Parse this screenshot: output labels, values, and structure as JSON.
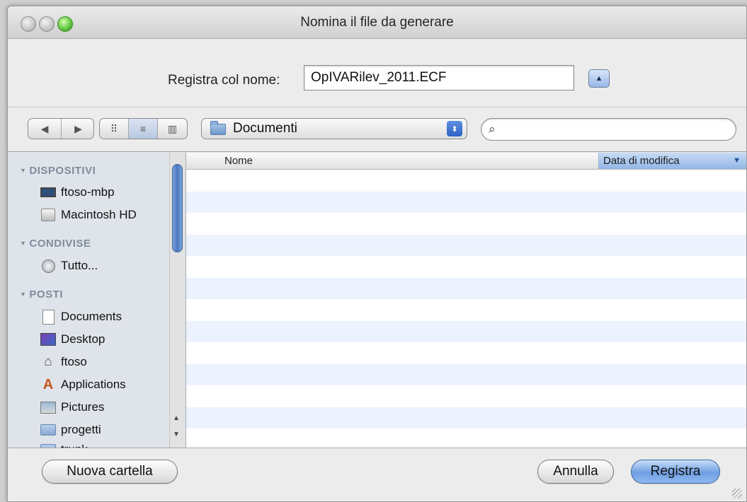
{
  "window": {
    "title": "Nomina il file da generare"
  },
  "save": {
    "label": "Registra col nome:",
    "filename": "OpIVARilev_2011.ECF",
    "expand_icon": "triangle-up"
  },
  "toolbar": {
    "back_icon": "◀",
    "forward_icon": "▶",
    "icon_view_icon": "⠿",
    "list_view_icon": "≡",
    "column_view_icon": "▥",
    "location": "Documenti",
    "search_placeholder": "",
    "search_icon": "⌕"
  },
  "sidebar": {
    "sections": {
      "devices": "DISPOSITIVI",
      "shared": "CONDIVISE",
      "places": "POSTI"
    },
    "devices": [
      {
        "label": "ftoso-mbp",
        "icon": "laptop-icon"
      },
      {
        "label": "Macintosh HD",
        "icon": "hard-disk-icon"
      }
    ],
    "shared": [
      {
        "label": "Tutto...",
        "icon": "network-icon"
      }
    ],
    "places": [
      {
        "label": "Documents",
        "icon": "document-icon"
      },
      {
        "label": "Desktop",
        "icon": "desktop-icon"
      },
      {
        "label": "ftoso",
        "icon": "home-icon"
      },
      {
        "label": "Applications",
        "icon": "applications-icon"
      },
      {
        "label": "Pictures",
        "icon": "pictures-icon"
      },
      {
        "label": "progetti",
        "icon": "folder-icon"
      },
      {
        "label": "trunk",
        "icon": "folder-icon"
      }
    ]
  },
  "filelist": {
    "columns": {
      "name": "Nome",
      "date": "Data di modifica"
    },
    "sort_indicator": "▼"
  },
  "buttons": {
    "new_folder": "Nuova cartella",
    "cancel": "Annulla",
    "save": "Registra"
  },
  "colors": {
    "accent": "#6f9fe2",
    "row_alt": "#edf3fe",
    "sidebar_bg": "#dfe4ea"
  }
}
